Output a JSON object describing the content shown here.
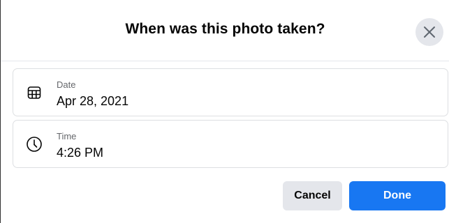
{
  "dialog": {
    "title": "When was this photo taken?",
    "close_icon": "close-icon"
  },
  "fields": {
    "date": {
      "icon": "calendar-icon",
      "label": "Date",
      "value": "Apr 28, 2021"
    },
    "time": {
      "icon": "clock-icon",
      "label": "Time",
      "value": "4:26 PM"
    }
  },
  "actions": {
    "cancel_label": "Cancel",
    "done_label": "Done"
  },
  "colors": {
    "primary": "#1877f2",
    "secondary_button": "#e4e6eb",
    "text_primary": "#050505",
    "text_secondary": "#65676b"
  }
}
